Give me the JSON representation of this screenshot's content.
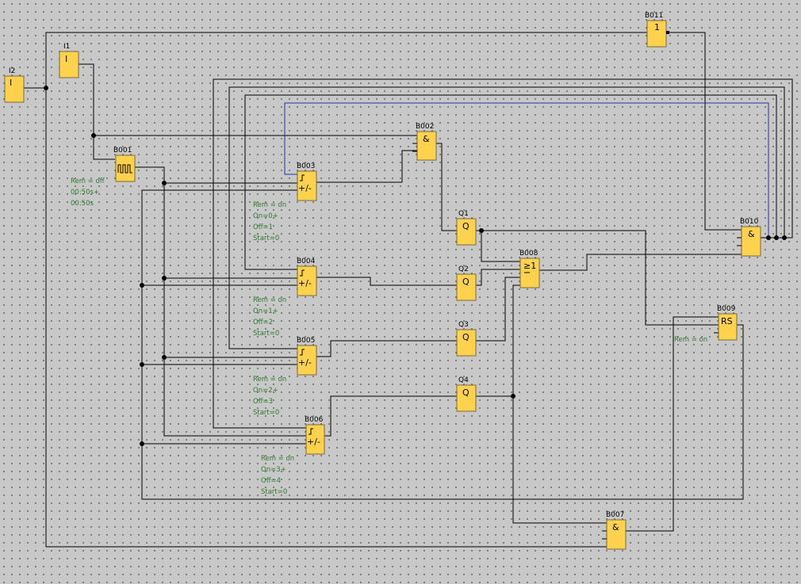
{
  "blocks": [
    {
      "id": "I2",
      "label": "I2",
      "symbol": "I"
    },
    {
      "id": "I1",
      "label": "I1",
      "symbol": "I"
    },
    {
      "id": "B001",
      "label": "B001",
      "symbol": "pulse"
    },
    {
      "id": "B002",
      "label": "B002",
      "symbol": "&"
    },
    {
      "id": "B003",
      "label": "B003",
      "symbol": "+/-"
    },
    {
      "id": "B004",
      "label": "B004",
      "symbol": "+/-"
    },
    {
      "id": "B005",
      "label": "B005",
      "symbol": "+/-"
    },
    {
      "id": "B006",
      "label": "B006",
      "symbol": "+/-"
    },
    {
      "id": "B007",
      "label": "B007",
      "symbol": "&"
    },
    {
      "id": "B008",
      "label": "B008",
      "symbol": "≥1"
    },
    {
      "id": "B009",
      "label": "B009",
      "symbol": "RS"
    },
    {
      "id": "B010",
      "label": "B010",
      "symbol": "&"
    },
    {
      "id": "B011",
      "label": "B011",
      "symbol": "1"
    },
    {
      "id": "Q1",
      "label": "Q1",
      "symbol": "Q"
    },
    {
      "id": "Q2",
      "label": "Q2",
      "symbol": "Q"
    },
    {
      "id": "Q3",
      "label": "Q3",
      "symbol": "Q"
    },
    {
      "id": "Q4",
      "label": "Q4",
      "symbol": "Q"
    }
  ],
  "params": {
    "B001": [
      "Rem = off",
      "00:50s+",
      "00:50s"
    ],
    "B003": [
      "Rem = on",
      "On=0+",
      "Off=1",
      "Start=0"
    ],
    "B004": [
      "Rem = on",
      "On=1+",
      "Off=2",
      "Start=0"
    ],
    "B005": [
      "Rem = on",
      "On=2+",
      "Off=3",
      "Start=0"
    ],
    "B006": [
      "Rem = on",
      "On=3+",
      "Off=4",
      "Start=0"
    ],
    "B009": [
      "Rem = on"
    ]
  },
  "colors": {
    "background": "#c8c8c8",
    "block_fill": "#ffd24d",
    "wire": "#000000",
    "feedback_wire": "#2233aa",
    "param_text": "#2f7a2f"
  }
}
